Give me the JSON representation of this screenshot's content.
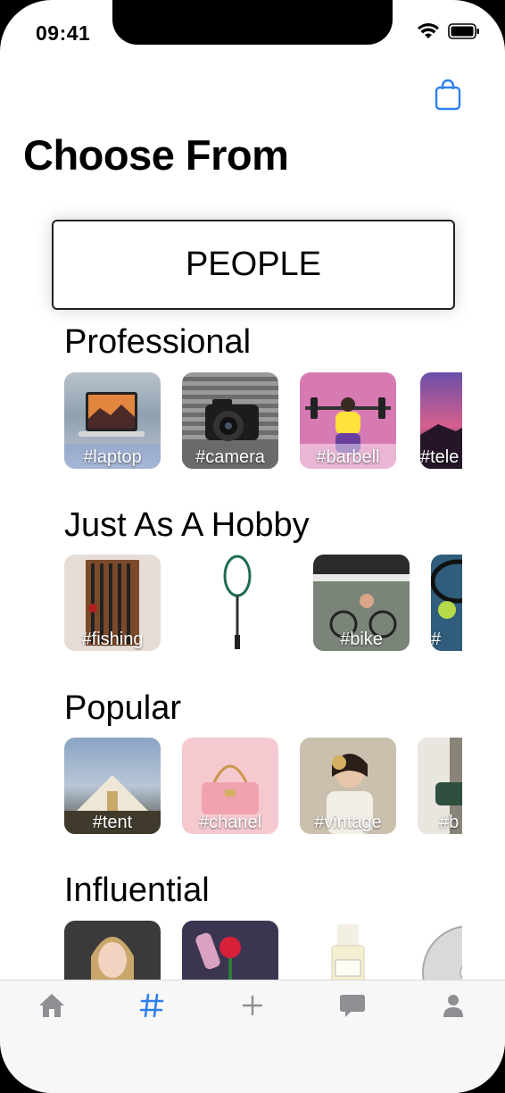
{
  "status": {
    "time": "09:41"
  },
  "header": {
    "title": "Choose From",
    "category_button": "PEOPLE"
  },
  "sections": [
    {
      "title": "Professional",
      "tiles": [
        "#laptop",
        "#camera",
        "#barbell",
        "#tele"
      ]
    },
    {
      "title": "Just As A Hobby",
      "tiles": [
        "#fishing",
        "",
        "#bike",
        "#"
      ]
    },
    {
      "title": "Popular",
      "tiles": [
        "#tent",
        "#chanel",
        "#vintage",
        "#b"
      ]
    },
    {
      "title": "Influential",
      "tiles": [
        "",
        "",
        "",
        ""
      ]
    }
  ],
  "tabbar": {
    "icons": [
      "home-icon",
      "hashtag-icon",
      "plus-icon",
      "chat-icon",
      "person-icon"
    ],
    "active": 1,
    "colors": {
      "active": "#2f80ed",
      "inactive": "#8e8e93"
    }
  }
}
